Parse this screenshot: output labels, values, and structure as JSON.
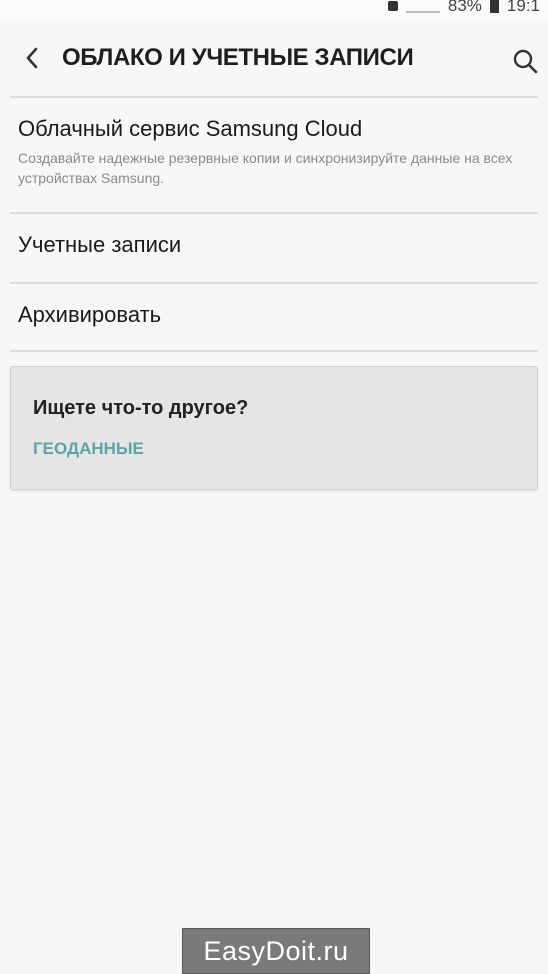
{
  "status_bar": {
    "battery_percent": "83%",
    "time": "19:1",
    "icons": [
      "notification-icon",
      "signal-icon",
      "battery-icon"
    ]
  },
  "header": {
    "title": "ОБЛАКО И УЧЕТНЫЕ ЗАПИСИ",
    "back_icon": "chevron-left-icon",
    "search_icon": "search-icon"
  },
  "items": [
    {
      "title": "Облачный сервис Samsung Cloud",
      "description": "Создавайте надежные резервные копии и синхронизируйте данные на всех устройствах Samsung."
    },
    {
      "title": "Учетные записи"
    },
    {
      "title": "Архивировать"
    }
  ],
  "suggestion": {
    "title": "Ищете что-то другое?",
    "link": "ГЕОДАННЫЕ"
  },
  "watermark": "EasyDoit.ru",
  "colors": {
    "accent": "#5ea3a8",
    "background": "#f7f7f7",
    "card": "#e5e5e5"
  }
}
